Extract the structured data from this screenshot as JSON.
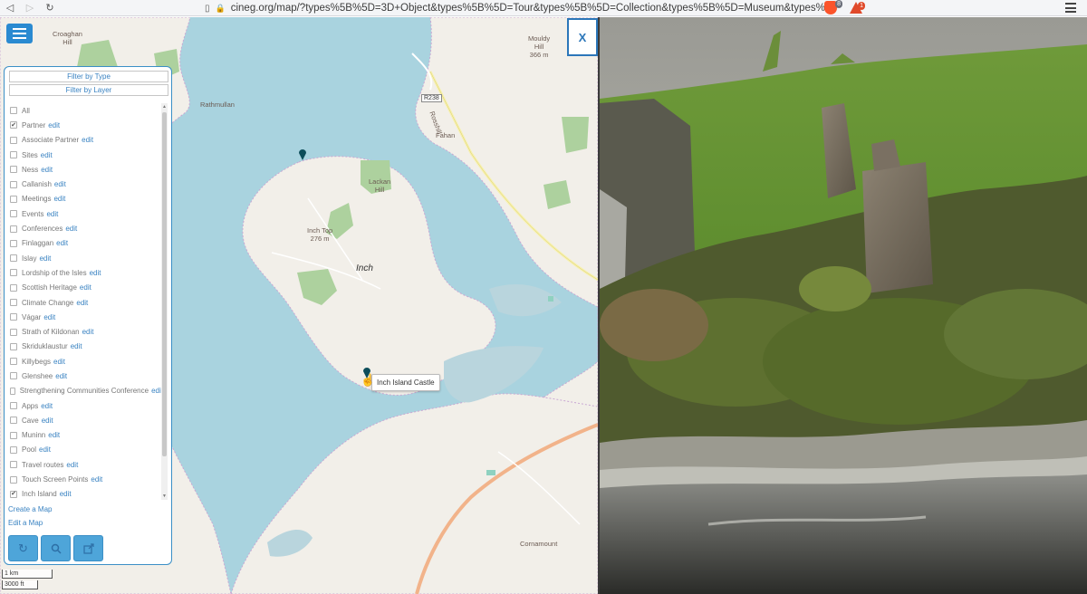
{
  "browser": {
    "url": "cineg.org/map/?types%5B%5D=3D+Object&types%5B%5D=Tour&types%5B%5D=Collection&types%5B%5D=Museum&types%5B%5D=Gallery&types%5...",
    "brave_badge": "8",
    "rewards_badge": "1"
  },
  "map": {
    "labels": {
      "croaghan": "Croaghan\nHill",
      "mouldy": "Mouldy\nHill\n366 m",
      "rathmullan": "Rathmullan",
      "fahan": "Fahan",
      "lackan": "Lackan\nHill",
      "inch_top": "Inch Top\n276 m",
      "inch": "Inch",
      "cornamount": "Cornamount",
      "road_r238": "R238",
      "road_name": "Rosshill"
    },
    "tooltip": "Inch Island Castle",
    "scale_km": "1 km",
    "scale_ft": "3000 ft",
    "close_label": "X"
  },
  "panel": {
    "filter_by_type": "Filter by Type",
    "filter_by_layer": "Filter by Layer",
    "edit_text": "edit",
    "items": [
      {
        "label": "All",
        "checked": false,
        "edit": false
      },
      {
        "label": "Partner",
        "checked": true,
        "edit": true
      },
      {
        "label": "Associate Partner",
        "checked": false,
        "edit": true
      },
      {
        "label": "Sites",
        "checked": false,
        "edit": true
      },
      {
        "label": "Ness",
        "checked": false,
        "edit": true
      },
      {
        "label": "Callanish",
        "checked": false,
        "edit": true
      },
      {
        "label": "Meetings",
        "checked": false,
        "edit": true
      },
      {
        "label": "Events",
        "checked": false,
        "edit": true
      },
      {
        "label": "Conferences",
        "checked": false,
        "edit": true
      },
      {
        "label": "Finlaggan",
        "checked": false,
        "edit": true
      },
      {
        "label": "Islay",
        "checked": false,
        "edit": true
      },
      {
        "label": "Lordship of the Isles",
        "checked": false,
        "edit": true
      },
      {
        "label": "Scottish Heritage",
        "checked": false,
        "edit": true
      },
      {
        "label": "Climate Change",
        "checked": false,
        "edit": true
      },
      {
        "label": "Vágar",
        "checked": false,
        "edit": true
      },
      {
        "label": "Strath of Kildonan",
        "checked": false,
        "edit": true
      },
      {
        "label": "Skriduklaustur",
        "checked": false,
        "edit": true
      },
      {
        "label": "Killybegs",
        "checked": false,
        "edit": true
      },
      {
        "label": "Glenshee",
        "checked": false,
        "edit": true
      },
      {
        "label": "Strengthening Communities Conference",
        "checked": false,
        "edit": true
      },
      {
        "label": "Apps",
        "checked": false,
        "edit": true
      },
      {
        "label": "Cave",
        "checked": false,
        "edit": true
      },
      {
        "label": "Muninn",
        "checked": false,
        "edit": true
      },
      {
        "label": "Pool",
        "checked": false,
        "edit": true
      },
      {
        "label": "Travel routes",
        "checked": false,
        "edit": true
      },
      {
        "label": "Touch Screen Points",
        "checked": false,
        "edit": true
      },
      {
        "label": "Inch Island",
        "checked": true,
        "edit": true
      }
    ],
    "create_map": "Create a Map",
    "edit_map": "Edit a Map",
    "buttons": [
      "refresh-icon",
      "search-icon",
      "share-icon"
    ]
  },
  "colors": {
    "accent": "#2a8ad1",
    "water": "#a9d3df",
    "land": "#f2efe9",
    "forest": "#add19e",
    "marker": "#0d4d5a"
  }
}
